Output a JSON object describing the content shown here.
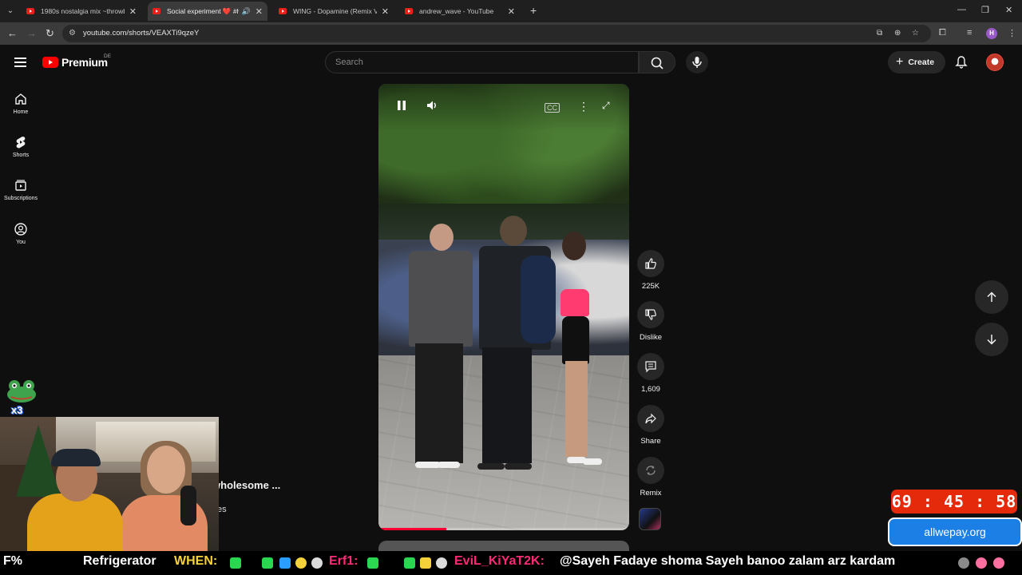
{
  "browser": {
    "tabs": [
      {
        "title": "1980s nostalgia mix ~throwbac",
        "active": false,
        "audio": false
      },
      {
        "title": "Social experiment ❤️ #hum",
        "active": true,
        "audio": true
      },
      {
        "title": "WING - Dopamine (Remix VER.",
        "active": false,
        "audio": false
      },
      {
        "title": "andrew_wave - YouTube",
        "active": false,
        "audio": false
      }
    ],
    "url": "youtube.com/shorts/VEAXTi9qzeY",
    "profile_initial": "H"
  },
  "header": {
    "logo_text": "Premium",
    "region": "DE",
    "search_placeholder": "Search",
    "create_label": "Create"
  },
  "guide": {
    "items": [
      {
        "label": "Home",
        "icon": "home-icon"
      },
      {
        "label": "Shorts",
        "icon": "shorts-icon"
      },
      {
        "label": "Subscriptions",
        "icon": "subscriptions-icon"
      },
      {
        "label": "You",
        "icon": "you-icon"
      }
    ]
  },
  "player": {
    "progress": 0.27
  },
  "actions": {
    "like_count": "225K",
    "dislike_label": "Dislike",
    "comment_count": "1,609",
    "share_label": "Share",
    "remix_label": "Remix"
  },
  "short": {
    "title_visible": "ity #wholesome ...",
    "subtitle_visible": "es"
  },
  "stream": {
    "frog_multiplier": "x3",
    "timer": "69 : 45 : 58",
    "promo_site": "allwepay.org",
    "ticker": {
      "left_edge": "F%",
      "item1": "Refrigerator",
      "item2": "WHEN:",
      "item3": "Erf1:",
      "item4": "EviL_KiYaT2K:",
      "item5": "@Sayeh Fadaye shoma Sayeh banoo zalam arz kardam"
    }
  },
  "colors": {
    "youtube_red": "#ff0000",
    "timer_bg": "#e52a0c",
    "promo_bg": "#1b7fe5",
    "ticker_yellow": "#f6d23a",
    "ticker_pink": "#ff2a76",
    "ticker_green": "#2bd651"
  }
}
